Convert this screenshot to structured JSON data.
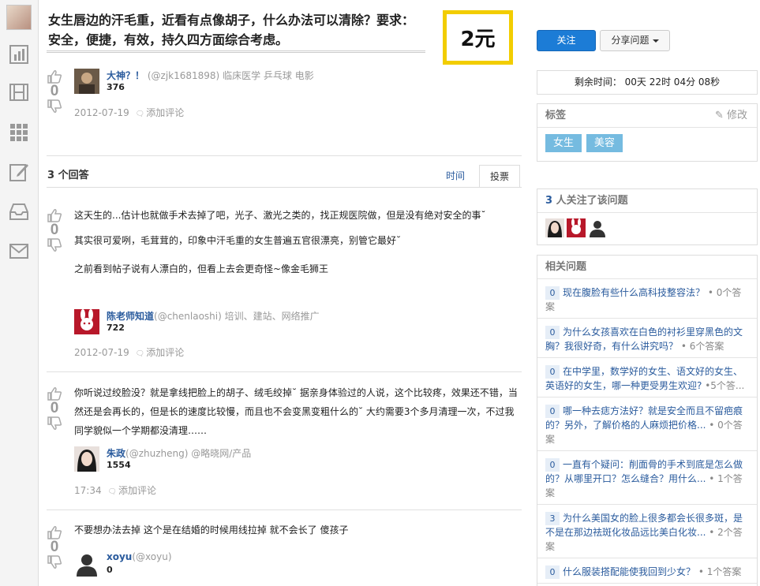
{
  "nav": {
    "icons": [
      "user-avatar",
      "chart-icon",
      "film-icon",
      "grid-icon",
      "edit-icon",
      "inbox-icon",
      "mail-icon"
    ]
  },
  "question": {
    "title": "女生唇边的汗毛重，近看有点像胡子，什么办法可以清除？要求：安全，便捷，有效，持久四方面综合考虑。",
    "bounty": "2元",
    "votes": "0",
    "author": {
      "name": "大神？！",
      "handle": "(@zjk1681898)",
      "tags": "临床医学 乒乓球 电影",
      "rep": "376"
    },
    "date": "2012-07-19",
    "comment_link": "添加评论"
  },
  "answers_header": {
    "count_label": "3 个回答",
    "tab_time": "时间",
    "tab_vote": "投票"
  },
  "answers": [
    {
      "votes": "0",
      "paragraphs": [
        "这天生的...估计也就做手术去掉了吧，光子、激光之类的，找正规医院做，但是没有绝对安全的事˘",
        "其实很可爱咧，毛茸茸的，印象中汗毛重的女生普遍五官很漂亮，别管它最好˘",
        "之前看到帖子说有人漂白的，但看上去会更奇怪~像金毛狮王"
      ],
      "author": {
        "name": "陈老师知道",
        "handle": "(@chenlaoshi)",
        "tags": "培训、建站、网络推广",
        "rep": "722"
      },
      "date": "2012-07-19",
      "comment_link": "添加评论"
    },
    {
      "votes": "0",
      "paragraphs": [
        "你听说过绞脸没？就是拿线把脸上的胡子、绒毛绞掉˘ 据亲身体验过的人说，这个比较疼，效果还不错，当然还是会再长的，但是长的速度比较慢，而且也不会变黑变粗什么的˘ 大约需要3个多月清理一次，不过我同学貌似一个学期都没清理……"
      ],
      "author": {
        "name": "朱政",
        "handle": "(@zhuzheng)",
        "tags": "@略晓网/产品",
        "rep": "1554"
      },
      "date": "17:34",
      "comment_link": "添加评论"
    },
    {
      "votes": "0",
      "paragraphs": [
        "不要想办法去掉 这个是在结婚的时候用线拉掉 就不会长了 傻孩子"
      ],
      "author": {
        "name": "xoyu",
        "handle": "(@xoyu)",
        "tags": "",
        "rep": "0"
      }
    }
  ],
  "sidebar": {
    "follow_button": "关注",
    "share_button": "分享问题",
    "timer": "剩余时间： 00天 22时 04分 08秒",
    "tags_title": "标签",
    "tags_edit": "修改",
    "tags": [
      "女生",
      "美容"
    ],
    "followers_count": "3",
    "followers_label": " 人关注了该问题",
    "related_title": "相关问题",
    "related": [
      {
        "n": "0",
        "text": "现在腹脸有些什么高科技整容法？",
        "answers": " • 0个答案"
      },
      {
        "n": "0",
        "text": "为什么女孩喜欢在白色的衬衫里穿黑色的文胸？我很好奇，有什么讲究吗？",
        "answers": " • 6个答案"
      },
      {
        "n": "0",
        "text": "在中学里，数学好的女生、语文好的女生、英语好的女生，哪一种更受男生欢迎?",
        "answers": " •5个答..."
      },
      {
        "n": "0",
        "text": "哪一种去痣方法好？就是安全而且不留疤痕的？另外，了解价格的人麻烦把价格...",
        "answers": " • 0个答案"
      },
      {
        "n": "0",
        "text": "一直有个疑问：削面骨的手术到底是怎么做的？从哪里开口？怎么缝合？用什么...",
        "answers": " • 1个答案"
      },
      {
        "n": "3",
        "text": "为什么美国女的脸上很多都会长很多斑，是不是在那边祛斑化妆品远比美白化妆...",
        "answers": " • 2个答案"
      },
      {
        "n": "0",
        "text": "什么服装搭配能使我回到少女？",
        "answers": " • 1个答案"
      }
    ]
  }
}
